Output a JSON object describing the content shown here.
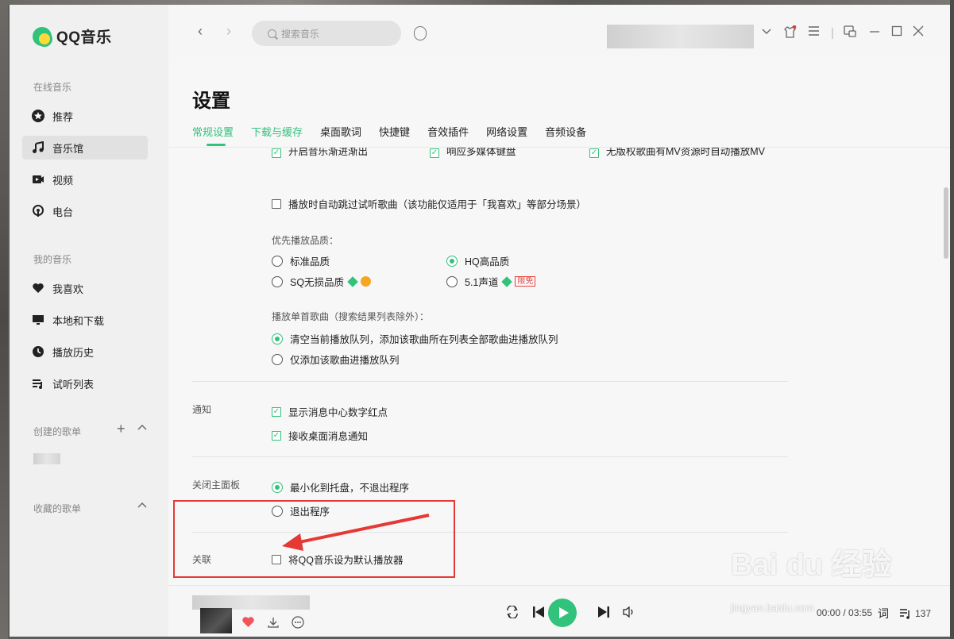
{
  "app": {
    "name": "QQ音乐"
  },
  "sidebar": {
    "sections": {
      "online": "在线音乐",
      "mine": "我的音乐",
      "created": "创建的歌单",
      "collected": "收藏的歌单"
    },
    "items": [
      {
        "label": "推荐",
        "icon": "star-icon"
      },
      {
        "label": "音乐馆",
        "icon": "music-note-icon",
        "active": true
      },
      {
        "label": "视频",
        "icon": "video-icon"
      },
      {
        "label": "电台",
        "icon": "radio-icon"
      },
      {
        "label": "我喜欢",
        "icon": "heart-icon"
      },
      {
        "label": "本地和下载",
        "icon": "monitor-icon"
      },
      {
        "label": "播放历史",
        "icon": "clock-icon"
      },
      {
        "label": "试听列表",
        "icon": "playlist-icon"
      }
    ]
  },
  "topbar": {
    "search_placeholder": "搜索音乐",
    "back": "‹",
    "forward": "›"
  },
  "settings": {
    "title": "设置",
    "tabs": [
      "常规设置",
      "下载与缓存",
      "桌面歌词",
      "快捷键",
      "音效插件",
      "网络设置",
      "音频设备"
    ],
    "partial_row": [
      "开启音乐渐进渐出",
      "响应多媒体键盘",
      "无版权歌曲有MV资源时自动播放MV"
    ],
    "skip_trial": "播放时自动跳过试听歌曲（该功能仅适用于「我喜欢」等部分场景）",
    "quality": {
      "label": "优先播放品质：",
      "standard": "标准品质",
      "hq": "HQ高品质",
      "sq": "SQ无损品质",
      "surround": "5.1声道",
      "limited_tag": "限免"
    },
    "single_play": {
      "label": "播放单首歌曲（搜索结果列表除外）：",
      "option1": "清空当前播放队列，添加该歌曲所在列表全部歌曲进播放队列",
      "option2": "仅添加该歌曲进播放队列"
    },
    "notify": {
      "label": "通知",
      "option1": "显示消息中心数字红点",
      "option2": "接收桌面消息通知"
    },
    "close_panel": {
      "label": "关闭主面板",
      "option1": "最小化到托盘，不退出程序",
      "option2": "退出程序"
    },
    "association": {
      "label": "关联",
      "option1": "将QQ音乐设为默认播放器"
    }
  },
  "player": {
    "time": "00:00 / 03:55",
    "lyric_button": "词",
    "playlist_count": "137"
  },
  "watermark": {
    "main": "Bai du 经验",
    "sub": "jingyan.baidu.com"
  },
  "colors": {
    "accent": "#31c27c",
    "annotation": "#e53935"
  }
}
